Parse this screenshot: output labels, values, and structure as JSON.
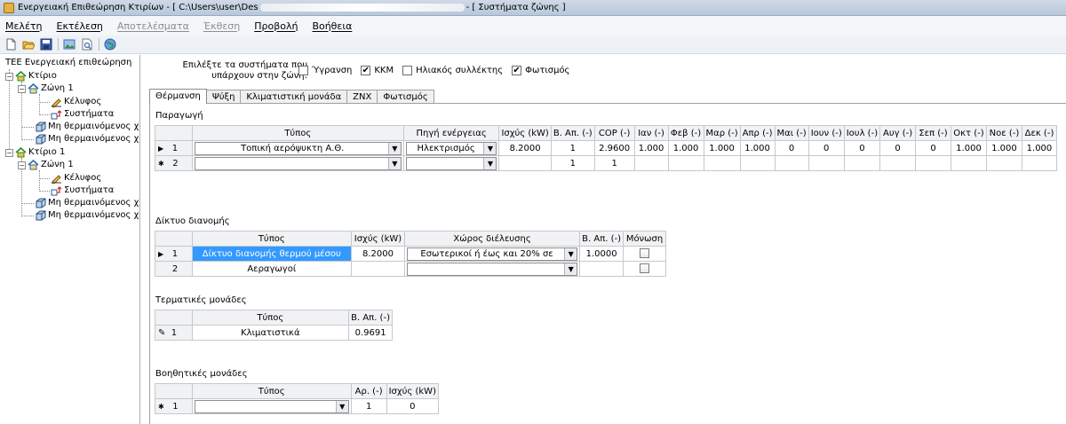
{
  "window": {
    "title_left": "Ενεργειακή Επιθεώρηση Κτιρίων - [ C:\\Users\\user\\Des",
    "title_right": "- [ Συστήματα ζώνης ]"
  },
  "menu": [
    {
      "label": "Μελέτη",
      "enabled": true
    },
    {
      "label": "Εκτέλεση",
      "enabled": true
    },
    {
      "label": "Αποτελέσματα",
      "enabled": false
    },
    {
      "label": "Έκθεση",
      "enabled": false
    },
    {
      "label": "Προβολή",
      "enabled": true
    },
    {
      "label": "Βοήθεια",
      "enabled": true
    }
  ],
  "toolbar_icons": [
    "new-file-icon",
    "open-folder-icon",
    "save-icon",
    "image-icon",
    "print-preview-icon",
    "globe-icon"
  ],
  "tree": {
    "root": "ΤΕΕ Ενεργειακή επιθεώρηση",
    "building1": "Κτίριο",
    "zone1": "Ζώνη 1",
    "shell1": "Κέλυφος",
    "systems1": "Συστήματα",
    "unheated1a": "Μη θερμαινόμενος χώ",
    "unheated1b": "Μη θερμαινόμενος χώ",
    "building2": "Κτίριο 1",
    "zone2": "Ζώνη 1",
    "shell2": "Κέλυφος",
    "systems2": "Συστήματα",
    "unheated2a": "Μη θερμαινόμενος χώ",
    "unheated2b": "Μη θερμαινόμενος χώ"
  },
  "systems_prompt": {
    "line1": "Επιλέξτε τα συστήματα που",
    "line2": "υπάρχουν στην ζώνη:"
  },
  "system_checks": [
    {
      "label": "Ύγρανση",
      "checked": false
    },
    {
      "label": "ΚΚΜ",
      "checked": true
    },
    {
      "label": "Ηλιακός συλλέκτης",
      "checked": false
    },
    {
      "label": "Φωτισμός",
      "checked": true
    }
  ],
  "tabs": [
    "Θέρμανση",
    "Ψύξη",
    "Κλιματιστική μονάδα",
    "ΖΝΧ",
    "Φωτισμός"
  ],
  "production": {
    "title": "Παραγωγή",
    "headers": [
      "Τύπος",
      "Πηγή ενέργειας",
      "Ισχύς (kW)",
      "Β. Απ. (-)",
      "COP (-)",
      "Ιαν (-)",
      "Φεβ (-)",
      "Μαρ (-)",
      "Απρ (-)",
      "Μαι (-)",
      "Ιουν (-)",
      "Ιουλ (-)",
      "Αυγ (-)",
      "Σεπ (-)",
      "Οκτ (-)",
      "Νοε (-)",
      "Δεκ (-)"
    ],
    "rows": [
      {
        "num": "1",
        "marker": "▶",
        "type": "Τοπική αερόψυκτη Α.Θ.",
        "source": "Ηλεκτρισμός",
        "power": "8.2000",
        "b": "1",
        "cop": "2.9600",
        "months": [
          "1.000",
          "1.000",
          "1.000",
          "1.000",
          "0",
          "0",
          "0",
          "0",
          "0",
          "1.000",
          "1.000",
          "1.000"
        ]
      },
      {
        "num": "2",
        "marker": "✱",
        "type": "",
        "source": "",
        "power": "",
        "b": "1",
        "cop": "1",
        "months": [
          "",
          "",
          "",
          "",
          "",
          "",
          "",
          "",
          "",
          "",
          "",
          ""
        ]
      }
    ]
  },
  "distribution": {
    "title": "Δίκτυο διανομής",
    "headers": [
      "Τύπος",
      "Ισχύς (kW)",
      "Χώρος διέλευσης",
      "Β. Απ. (-)",
      "Μόνωση"
    ],
    "rows": [
      {
        "num": "1",
        "marker": "▶",
        "type": "Δίκτυο διανομής θερμού μέσου",
        "power": "8.2000",
        "space": "Εσωτερικοί  ή έως και 20% σε",
        "b": "1.0000",
        "insulated": false
      },
      {
        "num": "2",
        "marker": "",
        "type": "Αεραγωγοί",
        "power": "",
        "space": "",
        "b": "",
        "insulated": false
      }
    ]
  },
  "terminals": {
    "title": "Τερματικές μονάδες",
    "headers": [
      "Τύπος",
      "Β. Απ. (-)"
    ],
    "rows": [
      {
        "num": "1",
        "marker": "✎",
        "type": "Κλιματιστικά",
        "b": "0.9691"
      }
    ]
  },
  "auxiliary": {
    "title": "Βοηθητικές μονάδες",
    "headers": [
      "Τύπος",
      "Αρ. (-)",
      "Ισχύς (kW)"
    ],
    "rows": [
      {
        "num": "1",
        "marker": "✱",
        "type": "",
        "count": "1",
        "power": "0"
      }
    ]
  }
}
